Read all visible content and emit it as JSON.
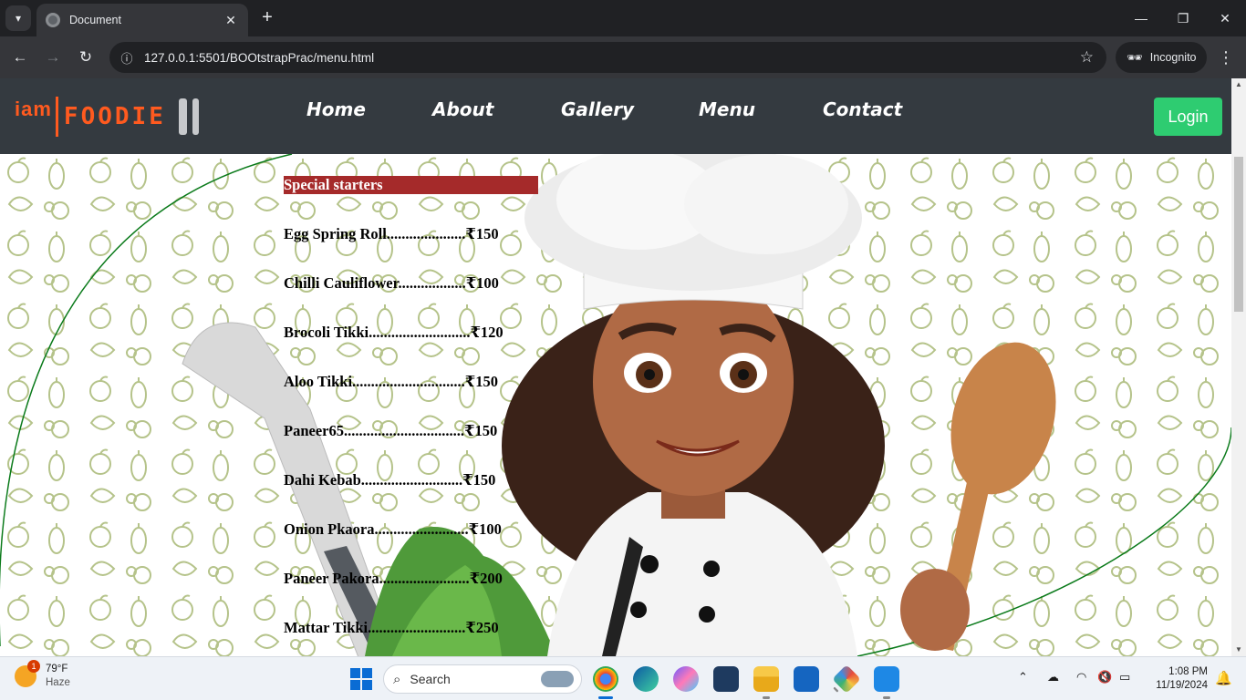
{
  "browser": {
    "tab_title": "Document",
    "tab_close": "✕",
    "new_tab": "+",
    "url": "127.0.0.1:5501/BOOtstrapPrac/menu.html",
    "incognito_label": "Incognito"
  },
  "site": {
    "logo_prefix": "iam",
    "logo_name": "FOODIE",
    "nav_links": [
      "Home",
      "About",
      "Gallery",
      "Menu",
      "Contact"
    ],
    "login_label": "Login",
    "colors": {
      "navbar": "#343a40",
      "login": "#2ecc71",
      "logo": "#ff5a1f",
      "heading_bg": "#a52a2a"
    }
  },
  "menu": {
    "heading": "Special starters",
    "items": [
      "Egg Spring Roll.....................₹150",
      "Chilli Cauliflower..................₹100",
      "Brocoli Tikki...........................₹120",
      "Aloo Tikki..............................₹150",
      "Paneer65................................₹150",
      "Dahi Kebab...........................₹150",
      "Onion Pkaora.........................₹100",
      "Paneer Pakora........................₹200",
      "Mattar Tikki..........................₹250"
    ]
  },
  "taskbar": {
    "weather_temp": "79°F",
    "weather_cond": "Haze",
    "weather_badge": "1",
    "search_placeholder": "Search",
    "time": "1:08 PM",
    "date": "11/19/2024"
  }
}
